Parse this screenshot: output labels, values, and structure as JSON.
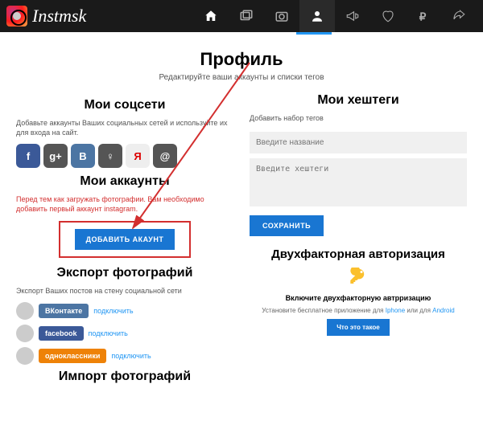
{
  "brand": "Instmsk",
  "page": {
    "title": "Профиль",
    "subtitle": "Редактируйте ваши аккаунты и списки тегов"
  },
  "left": {
    "socials_title": "Мои соцсети",
    "socials_desc": "Добавьте аккаунты Ваших социальных сетей и используйте их для входа на сайт.",
    "accounts_title": "Мои аккаунты",
    "warn": "Перед тем как загружать фотографии. Вам необходимо добавить первый аккаунт instagram.",
    "add_btn": "ДОБАВИТЬ АКАУНТ",
    "export_title": "Экспорт фотографий",
    "export_desc": "Экспорт Ваших постов на стену социальной сети",
    "connect": "подключить",
    "networks": {
      "vk": "ВКонтакте",
      "fb": "facebook",
      "ok": "одноклассники"
    },
    "import_title": "Импорт фотографий"
  },
  "right": {
    "hashtags_title": "Мои хештеги",
    "add_set": "Добавить набор тегов",
    "name_placeholder": "Введите название",
    "tags_placeholder": "Введите хештеги",
    "save_btn": "СОХРАНИТЬ",
    "twofa_title": "Двухфакторная авторизация",
    "twofa_enable": "Включите двухфакторную автрризацию",
    "twofa_install_pre": "Установите бесплатное приложение для ",
    "twofa_iphone": "Iphone",
    "twofa_or": " или для ",
    "twofa_android": "Android",
    "twofa_what": "Что это такое"
  },
  "social_icons": {
    "fb": "f",
    "gp": "g+",
    "vk": "B",
    "ok": "♀",
    "ya": "Я",
    "mr": "@"
  }
}
